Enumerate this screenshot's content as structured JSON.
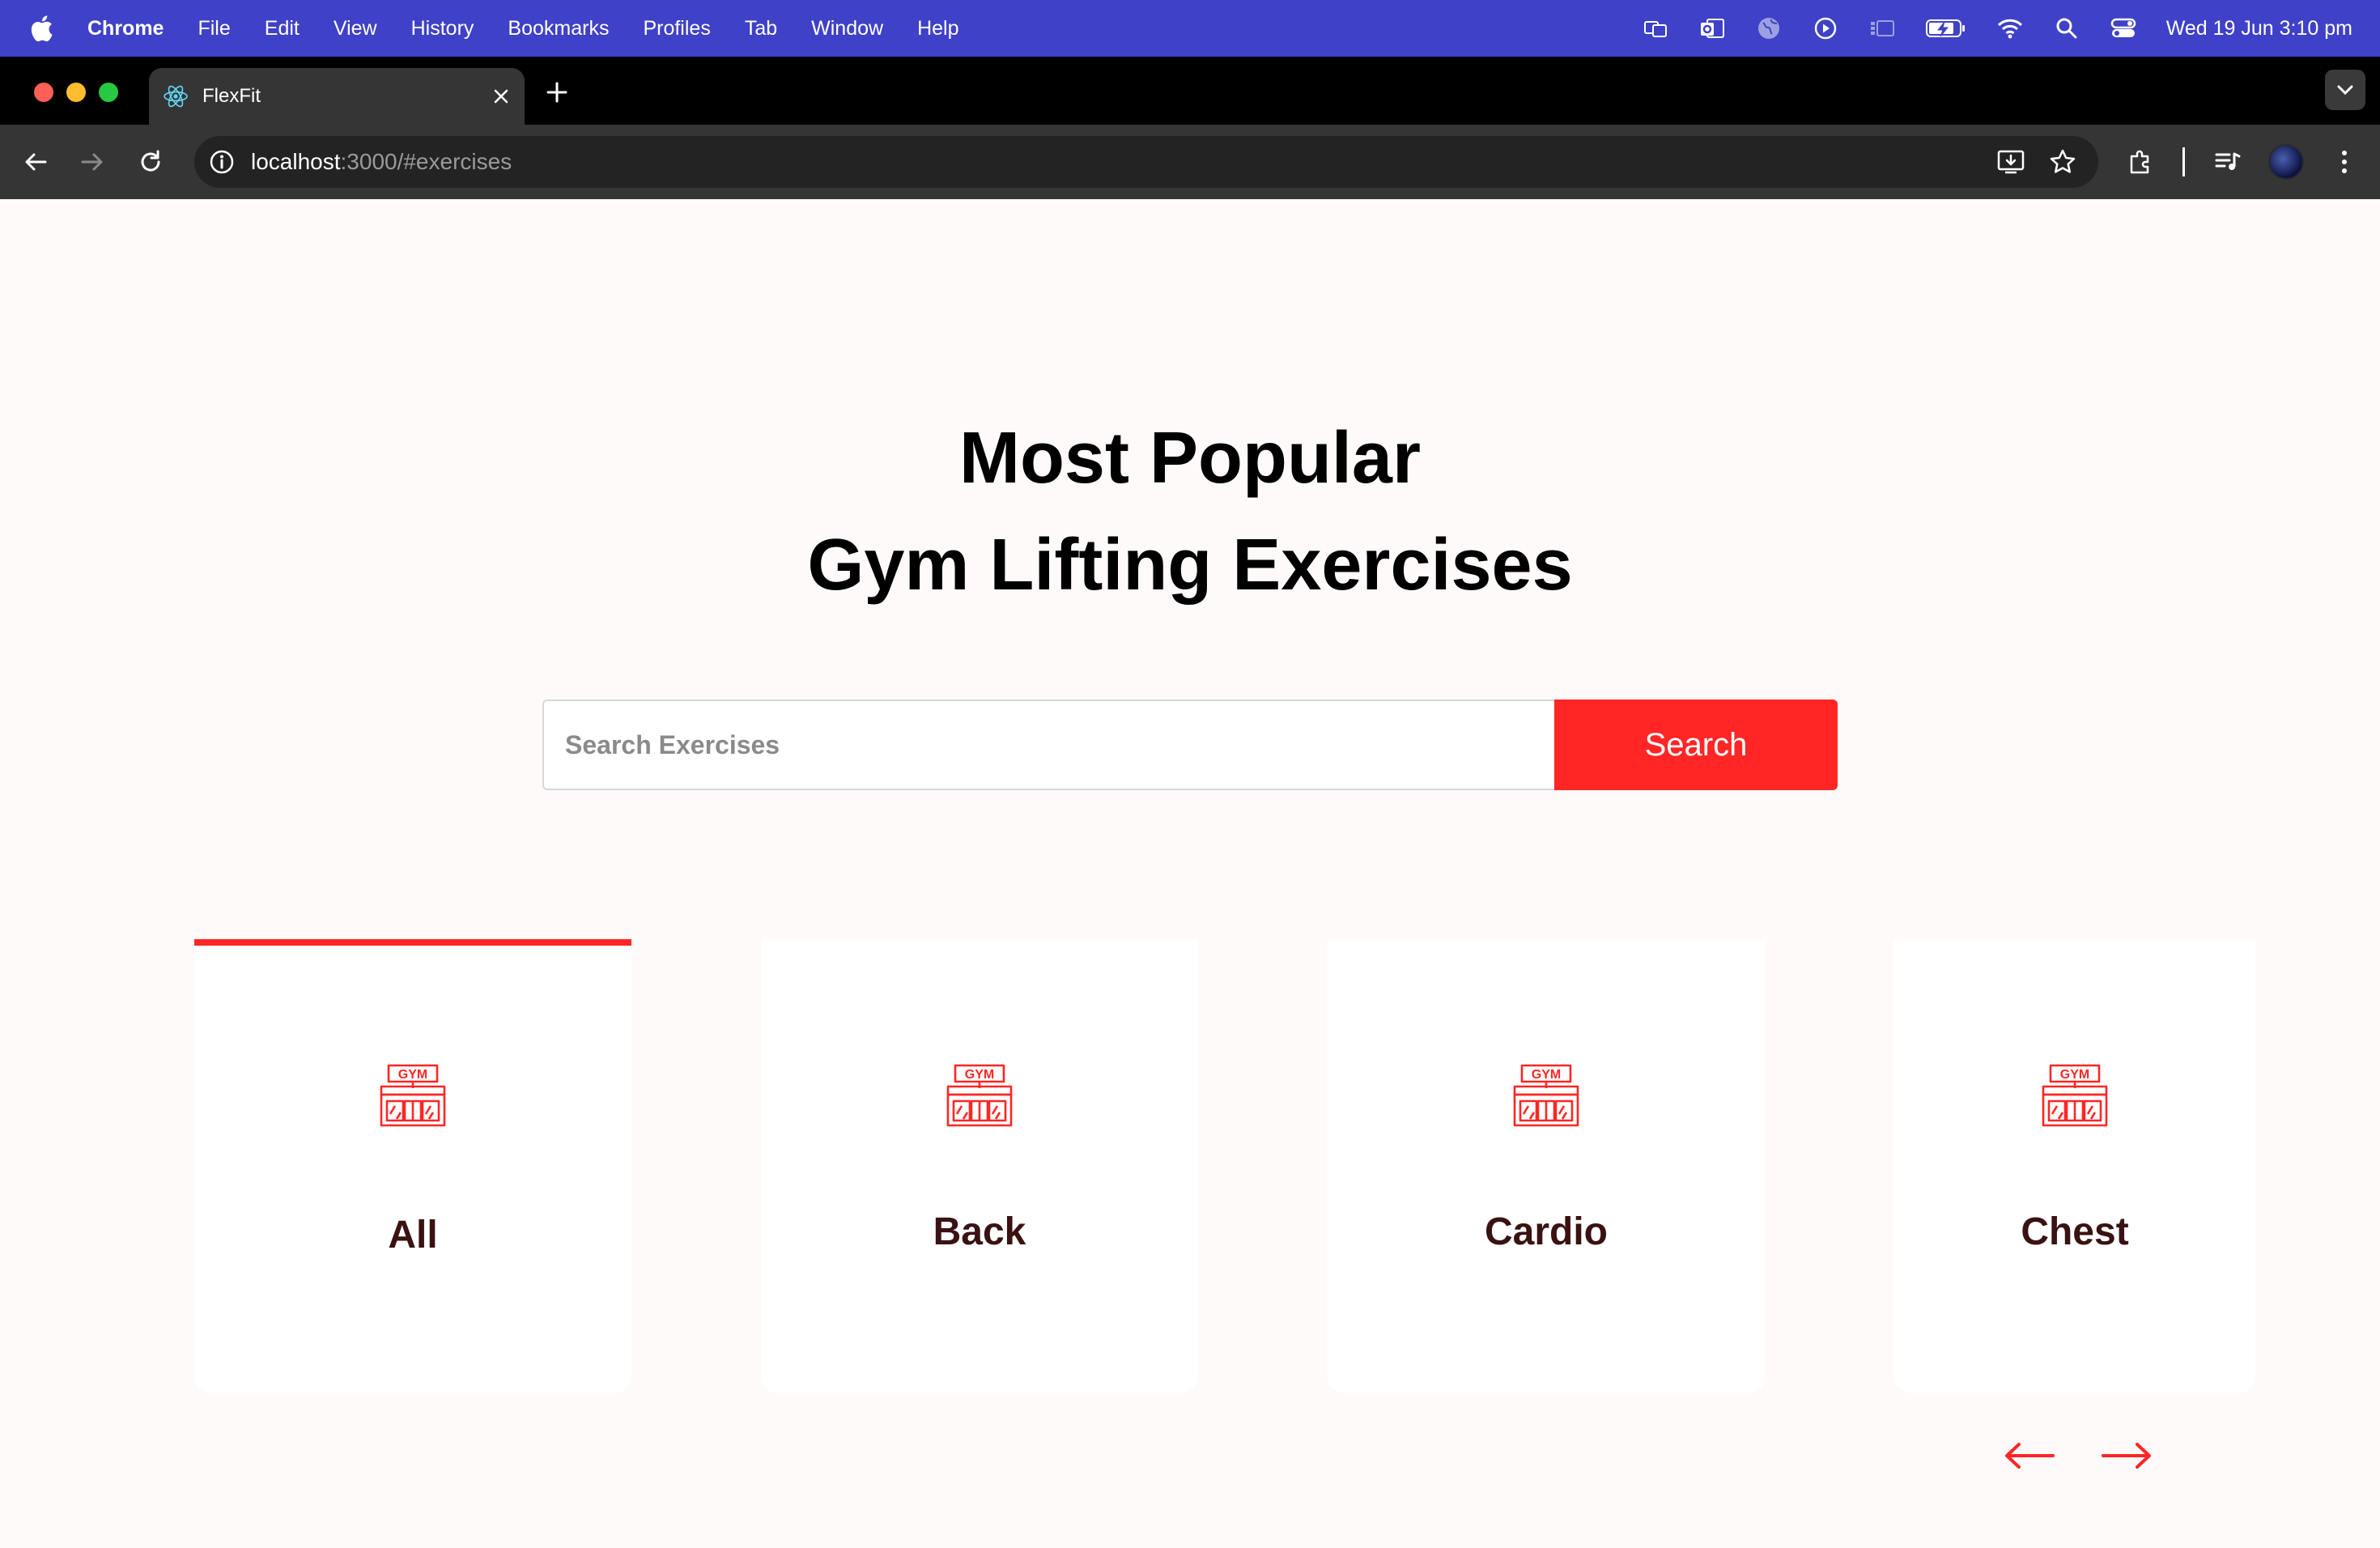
{
  "menubar": {
    "app": "Chrome",
    "items": [
      "File",
      "Edit",
      "View",
      "History",
      "Bookmarks",
      "Profiles",
      "Tab",
      "Window",
      "Help"
    ],
    "clock": "Wed 19 Jun  3:10 pm"
  },
  "browser": {
    "tab_title": "FlexFit",
    "url_host": "localhost",
    "url_rest": ":3000/#exercises"
  },
  "page": {
    "heading_line1": "Most Popular",
    "heading_line2": "Gym Lifting Exercises",
    "search_placeholder": "Search Exercises",
    "search_button": "Search",
    "categories": [
      {
        "label": "All",
        "active": true
      },
      {
        "label": "Back",
        "active": false
      },
      {
        "label": "Cardio",
        "active": false
      },
      {
        "label": "Chest",
        "active": false
      }
    ],
    "icon": "gym-icon",
    "gym_sign": "GYM"
  },
  "colors": {
    "accent": "#ff2625",
    "menubar": "#3f41c8",
    "page_bg": "#fffafa",
    "card_label": "#3a1212"
  }
}
